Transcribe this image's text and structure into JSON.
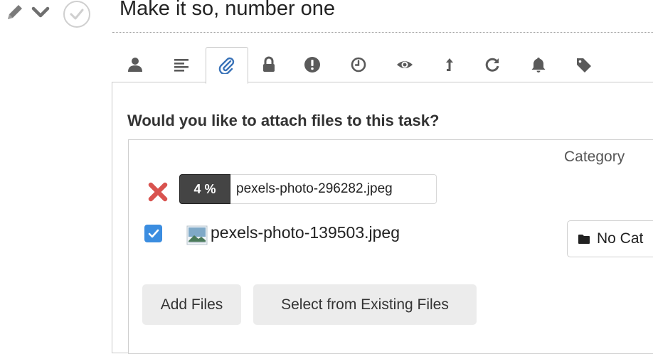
{
  "header": {
    "title": "Make it so, number one",
    "icons": [
      "pencil-icon",
      "chevron-down-icon",
      "check-circle-icon"
    ]
  },
  "tabs": [
    {
      "icon": "user-icon"
    },
    {
      "icon": "align-left-icon"
    },
    {
      "icon": "paperclip-icon",
      "active": true
    },
    {
      "icon": "lock-icon"
    },
    {
      "icon": "exclamation-icon"
    },
    {
      "icon": "clock-icon"
    },
    {
      "icon": "eye-icon"
    },
    {
      "icon": "arrow-up-icon"
    },
    {
      "icon": "refresh-icon"
    },
    {
      "icon": "bell-icon"
    },
    {
      "icon": "tag-icon"
    }
  ],
  "attachments": {
    "question": "Would you like to attach files to this task?",
    "category_header": "Category",
    "uploading": {
      "progress_label": "4 %",
      "progress_percent": 4,
      "filename": "pexels-photo-296282.jpeg"
    },
    "existing": {
      "checked": true,
      "filename": "pexels-photo-139503.jpeg",
      "category_value": "No Cat"
    },
    "buttons": {
      "add_files": "Add Files",
      "select_existing": "Select from Existing Files"
    }
  },
  "colors": {
    "accent_blue": "#3b8de0",
    "remove_red": "#d9534f",
    "active_tab_icon": "#3a73b8",
    "tab_icon": "#5a5a5a"
  }
}
